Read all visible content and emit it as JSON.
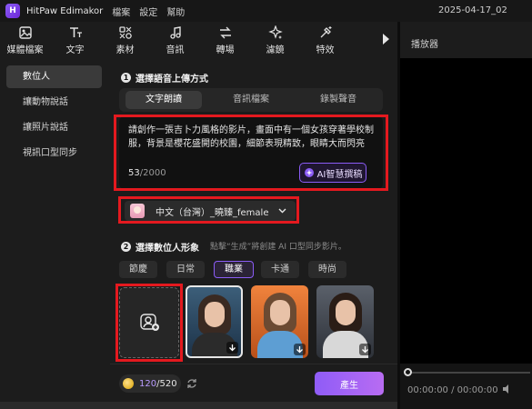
{
  "titlebar": {
    "app_name": "HitPaw Edimakor",
    "menus": [
      "檔案",
      "設定",
      "幫助"
    ],
    "project_title": "2025-04-17_02"
  },
  "toolbar": {
    "tools": [
      {
        "label": "媒體檔案",
        "icon": "media-icon"
      },
      {
        "label": "文字",
        "icon": "text-icon"
      },
      {
        "label": "素材",
        "icon": "elements-icon"
      },
      {
        "label": "音訊",
        "icon": "audio-icon"
      },
      {
        "label": "轉場",
        "icon": "transition-icon"
      },
      {
        "label": "濾鏡",
        "icon": "filter-icon"
      },
      {
        "label": "特效",
        "icon": "effects-icon"
      }
    ]
  },
  "player": {
    "title": "播放器",
    "timecode": "00:00:00 / 00:00:00"
  },
  "sidebar": {
    "items": [
      "數位人",
      "讓動物說話",
      "讓照片說話",
      "視訊口型同步"
    ],
    "active_index": 0
  },
  "section1": {
    "number": "1",
    "title": "選擇語音上傳方式",
    "tabs": [
      "文字朗讀",
      "音訊檔案",
      "錄製聲音"
    ],
    "active_tab": 0,
    "text_content": "請創作一張吉卜力風格的影片，畫面中有一個女孩穿著學校制服，背景是櫻花盛開的校園，細節表現精致，眼睛大而閃亮",
    "char_count": "53",
    "char_limit": "/2000",
    "ai_button": "AI智慧撰稿",
    "voice": "中文（台灣）_曉臻_female"
  },
  "section2": {
    "number": "2",
    "title": "選擇數位人形象",
    "hint": "點擊“生成”將創建 AI 口型同步影片。",
    "categories": [
      "節慶",
      "日常",
      "職業",
      "卡通",
      "時尚"
    ],
    "active_category": 2
  },
  "footer": {
    "credits_used": "120",
    "credits_total": "/520",
    "generate_label": "產生"
  },
  "colors": {
    "accent": "#8b5cf6",
    "highlight": "#e4191f",
    "background": "#1c1c1c"
  }
}
